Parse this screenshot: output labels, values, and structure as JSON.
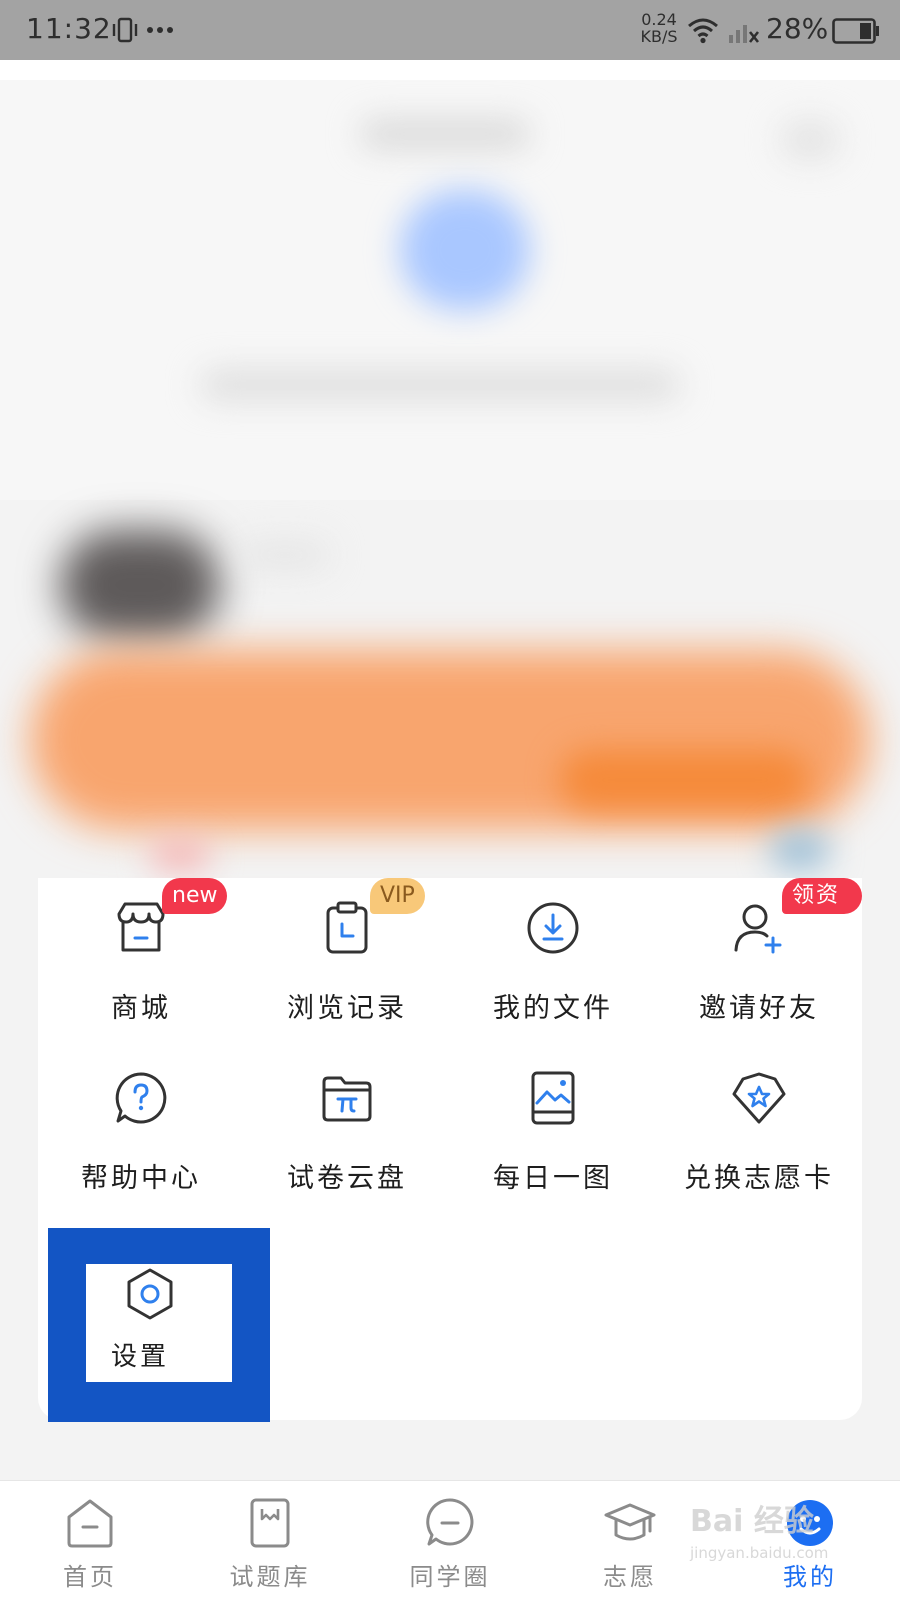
{
  "status_bar": {
    "time": "11:32",
    "net_speed_value": "0.24",
    "net_speed_unit": "KB/S",
    "battery": "28%"
  },
  "menu": {
    "items": [
      {
        "label": "商城",
        "badge": "new"
      },
      {
        "label": "浏览记录",
        "badge": "VIP"
      },
      {
        "label": "我的文件"
      },
      {
        "label": "邀请好友",
        "badge": "领资料"
      },
      {
        "label": "帮助中心"
      },
      {
        "label": "试卷云盘"
      },
      {
        "label": "每日一图"
      },
      {
        "label": "兑换志愿卡"
      },
      {
        "label": "设置"
      }
    ]
  },
  "bottom_nav": {
    "items": [
      {
        "label": "首页"
      },
      {
        "label": "试题库"
      },
      {
        "label": "同学圈"
      },
      {
        "label": "志愿"
      },
      {
        "label": "我的"
      }
    ],
    "active_index": 4
  },
  "watermark": {
    "main": "Bai 经验",
    "sub": "jingyan.baidu.com"
  },
  "colors": {
    "accent": "#1c6ef2",
    "icon_accent": "#2f80ed",
    "badge_red": "#f2384c",
    "badge_vip": "#f8c879",
    "highlight": "#1355c4"
  }
}
